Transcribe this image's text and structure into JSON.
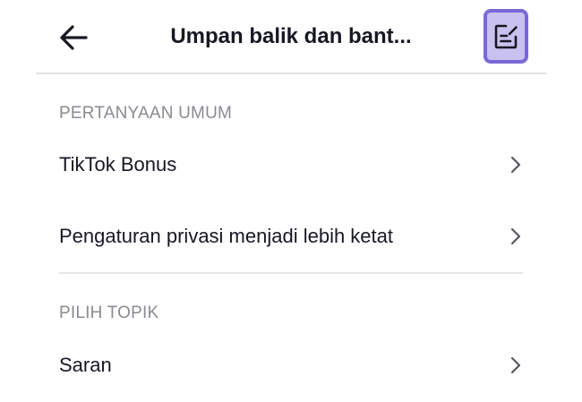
{
  "header": {
    "title": "Umpan balik dan bant...",
    "back_icon": "arrow-left-icon",
    "edit_icon": "edit-note-icon",
    "edit_button_highlight_color": "#7a67d8"
  },
  "sections": [
    {
      "label": "PERTANYAAN UMUM",
      "items": [
        {
          "label": "TikTok Bonus"
        },
        {
          "label": "Pengaturan privasi menjadi lebih ketat"
        }
      ]
    },
    {
      "label": "PILIH TOPIK",
      "items": [
        {
          "label": "Saran"
        }
      ]
    }
  ]
}
